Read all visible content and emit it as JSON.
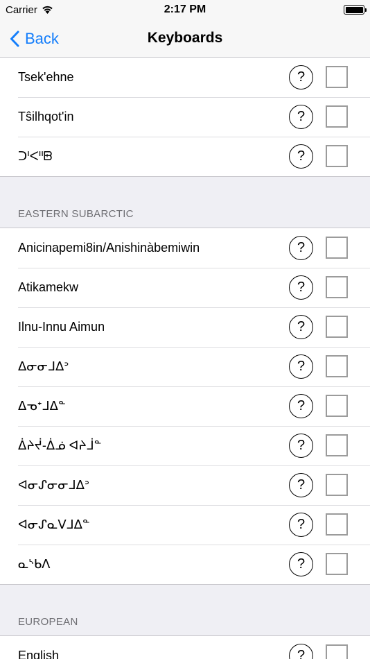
{
  "status_bar": {
    "carrier": "Carrier",
    "time": "2:17 PM",
    "battery_level": 1.0
  },
  "nav": {
    "back_label": "Back",
    "title": "Keyboards"
  },
  "group_top": {
    "items": [
      {
        "label": "Tsek'ehne"
      },
      {
        "label": "Tŝilhqot'in"
      },
      {
        "label": "ᑐᑊᐸᐦᗸ"
      }
    ]
  },
  "sections": [
    {
      "header": "EASTERN SUBARCTIC",
      "items": [
        {
          "label": "Anicinapemi8in/Anishinàbemiwin"
        },
        {
          "label": "Atikamekw"
        },
        {
          "label": "Ilnu-Innu Aimun"
        },
        {
          "label": "ᐃᓂᓂᒧᐃᐣ"
        },
        {
          "label": "ᐃᓀᐩᒧᐃᓐ"
        },
        {
          "label": "ᐄᔨᔫ-ᐄᓅ ᐊᔨᒨᓐ"
        },
        {
          "label": "ᐊᓂᔑᓂᓂᒧᐃᐣ"
        },
        {
          "label": "ᐊᓂᔑᓇᐯᒧᐃᓐ"
        },
        {
          "label": "ᓇᔅᑲᐱ"
        }
      ]
    },
    {
      "header": "EUROPEAN",
      "items": [
        {
          "label": "English"
        }
      ]
    }
  ],
  "help_label": "?",
  "colors": {
    "accent": "#147efb",
    "checkbox_border": "#9b9b9b",
    "section_header": "#6d6d72"
  }
}
